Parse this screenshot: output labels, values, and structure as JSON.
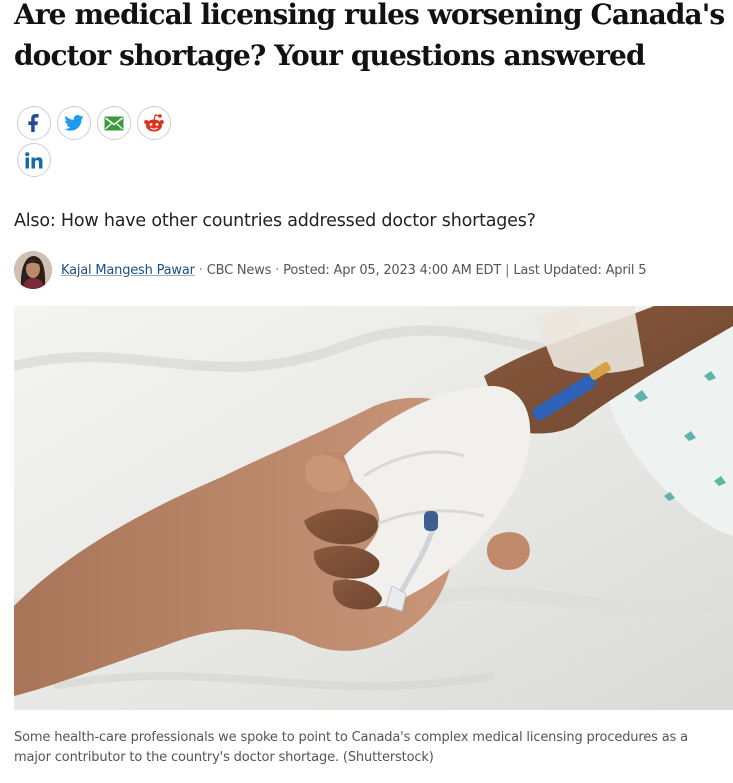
{
  "headline": "Are medical licensing rules worsening Canada's doctor shortage? Your questions answered",
  "share": {
    "facebook_icon": "facebook-icon",
    "twitter_icon": "twitter-icon",
    "email_icon": "email-icon",
    "reddit_icon": "reddit-icon",
    "linkedin_icon": "linkedin-icon",
    "colors": {
      "facebook": "#1f4e96",
      "twitter": "#1d9bf0",
      "email": "#3c9a3c",
      "reddit": "#e0301e",
      "linkedin": "#1a6aa8"
    }
  },
  "subhead": "Also: How have other countries addressed doctor shortages?",
  "byline": {
    "author": "Kajal Mangesh Pawar",
    "outlet": "CBC News",
    "posted": "Posted: Apr 05, 2023 4:00 AM EDT",
    "updated": "Last Updated: April 5",
    "dot1": "·",
    "dot2": "·",
    "bar": "|"
  },
  "photo": {
    "description_icon": "photo-child-hand-iv"
  },
  "caption": "Some health-care professionals we spoke to point to Canada's complex medical licensing procedures as a major contributor to the country's doctor shortage. (Shutterstock)"
}
